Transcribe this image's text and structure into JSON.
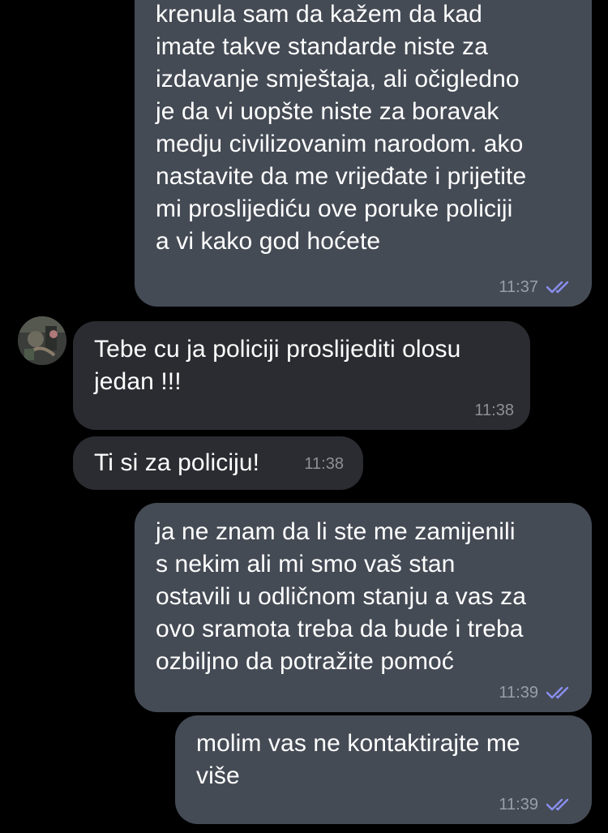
{
  "chat": {
    "accent_check_color": "#8a8ff0",
    "messages": [
      {
        "direction": "outgoing",
        "text": "krenula sam da kažem da kad\nimate takve standarde niste za\nizdavanje smještaja, ali očigledno\nje da vi uopšte niste za boravak\nmedju civilizovanim narodom. ako\nnastavite da me vrijeđate i prijetite\nmi proslijediću ove poruke policiji\na vi kako god hoćete",
        "time": "11:37",
        "status_icon": "double-check-icon"
      },
      {
        "direction": "incoming",
        "text": "Tebe cu ja policiji proslijediti olosu\njedan !!!",
        "time": "11:38"
      },
      {
        "direction": "incoming",
        "text": "Ti si za policiju!",
        "time": "11:38"
      },
      {
        "direction": "outgoing",
        "text": "ja ne znam da li ste me zamijenili\ns nekim ali mi smo vaš stan\nostavili u odličnom stanju a vas za\novo sramota treba da bude i treba\nozbiljno da potražite pomoć",
        "time": "11:39",
        "status_icon": "double-check-icon"
      },
      {
        "direction": "outgoing",
        "text": "molim vas ne kontaktirajte me\nviše",
        "time": "11:39",
        "status_icon": "double-check-icon"
      }
    ]
  }
}
